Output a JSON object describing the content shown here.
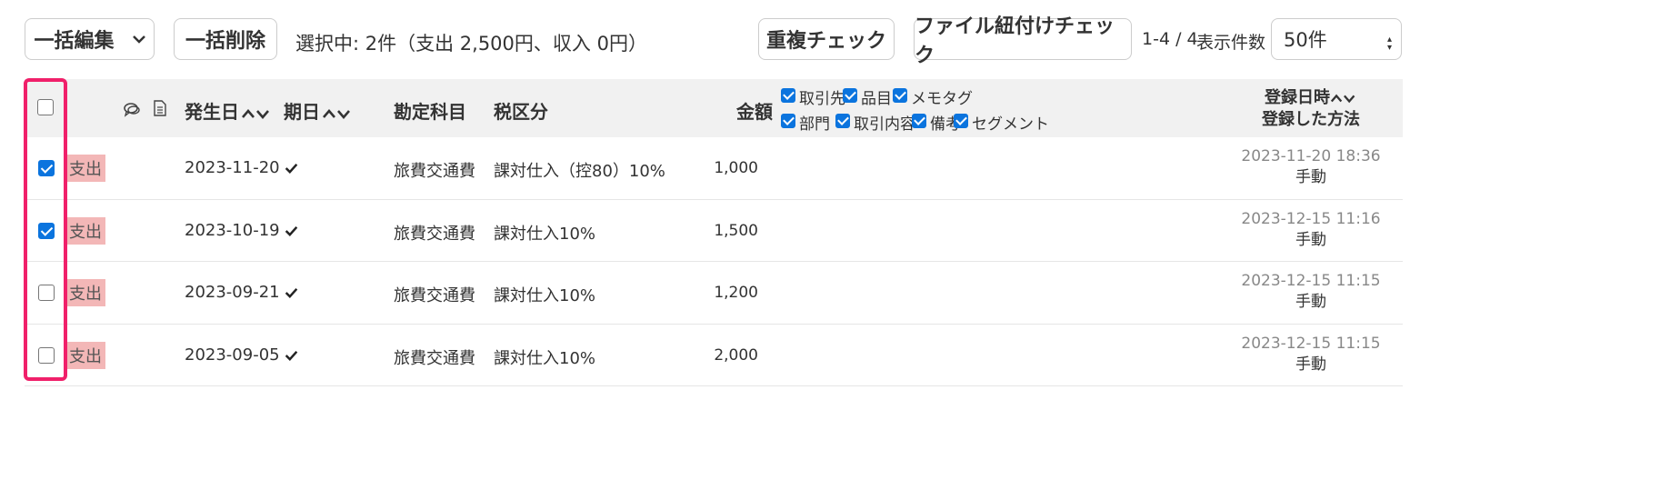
{
  "toolbar": {
    "bulk_edit": "一括編集",
    "bulk_delete": "一括削除",
    "selection_summary": "選択中: 2件（支出 2,500円、収入 0円）",
    "duplicate_check": "重複チェック",
    "file_link_check": "ファイル紐付けチェック",
    "range": "1-4 / 4",
    "page_size_label": "表示件数",
    "page_size_value": "50件"
  },
  "table": {
    "headers": {
      "occurred_date": "発生日",
      "due_date": "期日",
      "account": "勘定科目",
      "tax_class": "税区分",
      "amount": "金額",
      "registered_at": "登録日時",
      "registered_method": "登録した方法"
    },
    "header_all_checked": false,
    "column_options": [
      {
        "label": "取引先",
        "checked": true
      },
      {
        "label": "品目",
        "checked": true
      },
      {
        "label": "メモタグ",
        "checked": true
      },
      {
        "label": "部門",
        "checked": true
      },
      {
        "label": "取引内容",
        "checked": true
      },
      {
        "label": "備考",
        "checked": true
      },
      {
        "label": "セグメント",
        "checked": true
      }
    ],
    "rows": [
      {
        "checked": true,
        "type": "支出",
        "date": "2023-11-20",
        "account": "旅費交通費",
        "tax": "課対仕入（控80）10%",
        "amount": "1,000",
        "registered": "2023-11-20 18:36",
        "method": "手動"
      },
      {
        "checked": true,
        "type": "支出",
        "date": "2023-10-19",
        "account": "旅費交通費",
        "tax": "課対仕入10%",
        "amount": "1,500",
        "registered": "2023-12-15 11:16",
        "method": "手動"
      },
      {
        "checked": false,
        "type": "支出",
        "date": "2023-09-21",
        "account": "旅費交通費",
        "tax": "課対仕入10%",
        "amount": "1,200",
        "registered": "2023-12-15 11:15",
        "method": "手動"
      },
      {
        "checked": false,
        "type": "支出",
        "date": "2023-09-05",
        "account": "旅費交通費",
        "tax": "課対仕入10%",
        "amount": "2,000",
        "registered": "2023-12-15 11:15",
        "method": "手動"
      }
    ]
  },
  "colors": {
    "highlight": "#f0206a",
    "expense_badge": "#f3b7b7",
    "checkbox_checked": "#0b74de",
    "header_bg": "#f1f1f1"
  },
  "icons": [
    "chevron-down-icon",
    "comment-icon",
    "document-icon",
    "sort-icon",
    "checkmark-icon"
  ]
}
